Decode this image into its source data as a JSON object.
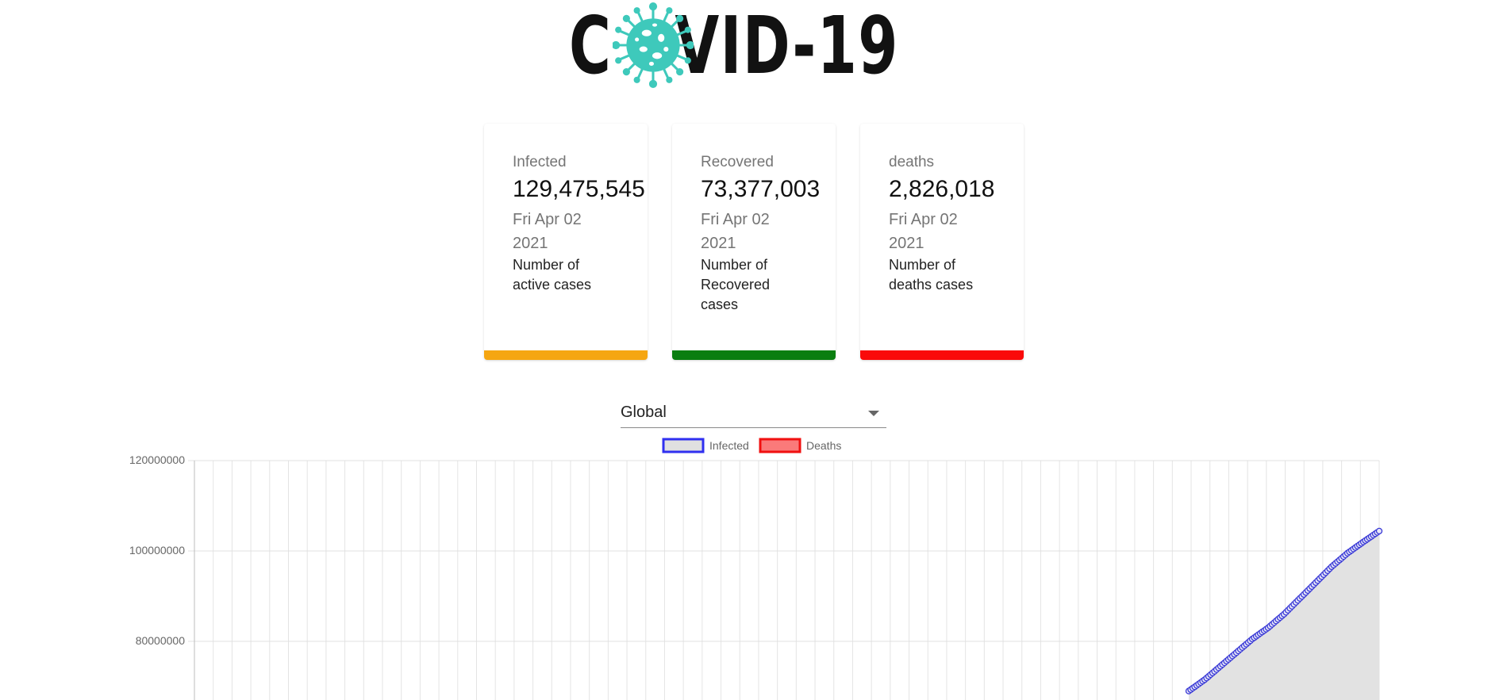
{
  "logo": {
    "text_left": "C",
    "text_right": "VID-19",
    "icon": "virus-icon",
    "icon_color": "#3ec9bb"
  },
  "cards": [
    {
      "label": "Infected",
      "value": "129,475,545",
      "date": "Fri Apr 02 2021",
      "description": "Number of active cases",
      "color": "#f5a612"
    },
    {
      "label": "Recovered",
      "value": "73,377,003",
      "date": "Fri Apr 02 2021",
      "description": "Number of Recovered cases",
      "color": "#0a7e10"
    },
    {
      "label": "deaths",
      "value": "2,826,018",
      "date": "Fri Apr 02 2021",
      "description": "Number of deaths cases",
      "color": "#fa0a0a"
    }
  ],
  "country_select": {
    "value": "Global",
    "icon": "chevron-down-icon"
  },
  "chart_data": {
    "type": "line",
    "legend": [
      {
        "name": "Infected",
        "border": "#3030f0",
        "fill": "#e0e0e0"
      },
      {
        "name": "Deaths",
        "border": "#f01010",
        "fill": "#fa7a7a"
      }
    ],
    "legend_position": "top",
    "y_ticks": [
      "120000000",
      "100000000",
      "80000000"
    ],
    "ylim": [
      60000000,
      120000000
    ],
    "grid": true,
    "series": [
      {
        "name": "Infected",
        "line_color": "#3a3ad6",
        "area_color": "#e2e2e2",
        "values": [
          69000000,
          71500000,
          74500000,
          77500000,
          80500000,
          83000000,
          86000000,
          89500000,
          93000000,
          96500000,
          99500000,
          102000000,
          104400000
        ]
      }
    ]
  }
}
